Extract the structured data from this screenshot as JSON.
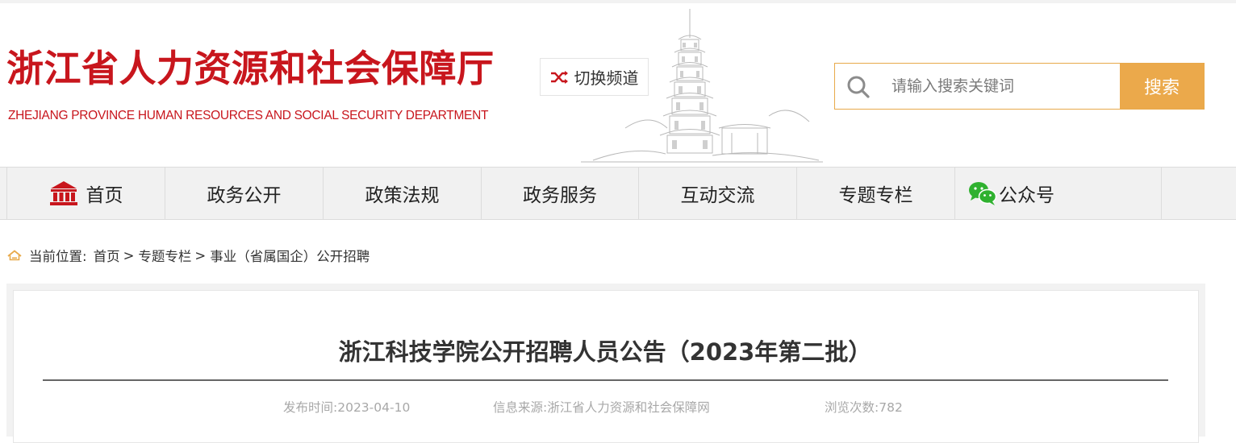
{
  "header": {
    "title": "浙江省人力资源和社会保障厅",
    "subtitle": "ZHEJIANG PROVINCE HUMAN RESOURCES AND SOCIAL SECURITY DEPARTMENT",
    "switch_channel_label": "切换频道"
  },
  "search": {
    "placeholder": "请输入搜索关键词",
    "button_label": "搜索"
  },
  "nav": {
    "items": [
      {
        "label": "首页",
        "icon": "government-building-icon"
      },
      {
        "label": "政务公开"
      },
      {
        "label": "政策法规"
      },
      {
        "label": "政务服务"
      },
      {
        "label": "互动交流"
      },
      {
        "label": "专题专栏"
      },
      {
        "label": "公众号",
        "icon": "wechat-icon"
      }
    ]
  },
  "breadcrumb": {
    "prefix": "当前位置:",
    "items": [
      "首页",
      "专题专栏",
      "事业（省属国企）公开招聘"
    ],
    "separator": ">"
  },
  "article": {
    "title": "浙江科技学院公开招聘人员公告（2023年第二批）",
    "publish_time": "发布时间:2023-04-10",
    "source": "信息来源:浙江省人力资源和社会保障网",
    "views": "浏览次数:782"
  },
  "colors": {
    "brand_red": "#c8161d",
    "accent_orange": "#eba94b",
    "nav_bg": "#f1f1f1"
  }
}
